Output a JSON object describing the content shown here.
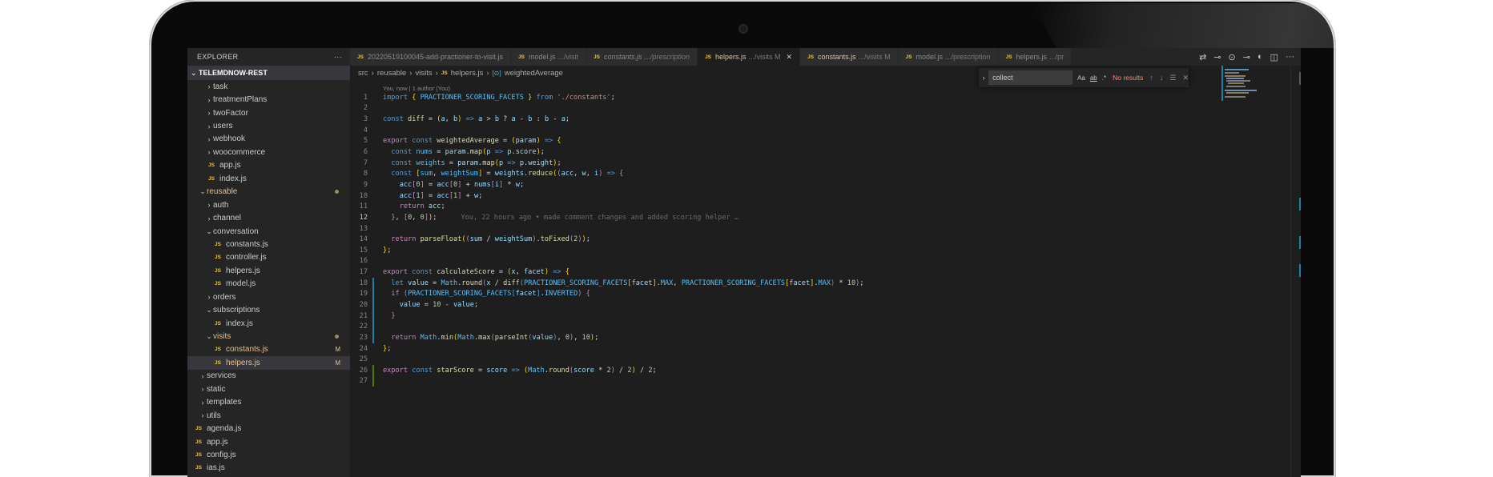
{
  "sidebar": {
    "title": "EXPLORER",
    "more": "···",
    "project": "TELEMDNOW-REST",
    "items": [
      {
        "type": "folder",
        "label": "task",
        "indent": 1,
        "open": false
      },
      {
        "type": "folder",
        "label": "treatmentPlans",
        "indent": 1,
        "open": false
      },
      {
        "type": "folder",
        "label": "twoFactor",
        "indent": 1,
        "open": false
      },
      {
        "type": "folder",
        "label": "users",
        "indent": 1,
        "open": false
      },
      {
        "type": "folder",
        "label": "webhook",
        "indent": 1,
        "open": false
      },
      {
        "type": "folder",
        "label": "woocommerce",
        "indent": 1,
        "open": false
      },
      {
        "type": "file",
        "label": "app.js",
        "indent": 1
      },
      {
        "type": "file",
        "label": "index.js",
        "indent": 1
      },
      {
        "type": "folder",
        "label": "reusable",
        "indent": 0,
        "open": true,
        "modified": true,
        "dot": true
      },
      {
        "type": "folder",
        "label": "auth",
        "indent": 1,
        "open": false
      },
      {
        "type": "folder",
        "label": "channel",
        "indent": 1,
        "open": false
      },
      {
        "type": "folder",
        "label": "conversation",
        "indent": 1,
        "open": true
      },
      {
        "type": "file",
        "label": "constants.js",
        "indent": 2
      },
      {
        "type": "file",
        "label": "controller.js",
        "indent": 2
      },
      {
        "type": "file",
        "label": "helpers.js",
        "indent": 2
      },
      {
        "type": "file",
        "label": "model.js",
        "indent": 2
      },
      {
        "type": "folder",
        "label": "orders",
        "indent": 1,
        "open": false
      },
      {
        "type": "folder",
        "label": "subscriptions",
        "indent": 1,
        "open": true
      },
      {
        "type": "file",
        "label": "index.js",
        "indent": 2
      },
      {
        "type": "folder",
        "label": "visits",
        "indent": 1,
        "open": true,
        "modified": true,
        "dot": true
      },
      {
        "type": "file",
        "label": "constants.js",
        "indent": 2,
        "modified": true,
        "badge": "M"
      },
      {
        "type": "file",
        "label": "helpers.js",
        "indent": 2,
        "modified": true,
        "badge": "M",
        "selected": true
      },
      {
        "type": "folder",
        "label": "services",
        "indent": 0,
        "open": false
      },
      {
        "type": "folder",
        "label": "static",
        "indent": 0,
        "open": false
      },
      {
        "type": "folder",
        "label": "templates",
        "indent": 0,
        "open": false
      },
      {
        "type": "folder",
        "label": "utils",
        "indent": 0,
        "open": false
      },
      {
        "type": "file",
        "label": "agenda.js",
        "indent": -1
      },
      {
        "type": "file",
        "label": "app.js",
        "indent": -1
      },
      {
        "type": "file",
        "label": "config.js",
        "indent": -1
      },
      {
        "type": "file",
        "label": "ias.js",
        "indent": -1
      }
    ]
  },
  "tabs": [
    {
      "label": "20220519100045-add-practioner-to-visit.js",
      "sub": "",
      "state": ""
    },
    {
      "label": "model.js",
      "sub": ".../visit",
      "state": ""
    },
    {
      "label": "constants.js",
      "sub": ".../prescription",
      "state": "italic"
    },
    {
      "label": "helpers.js",
      "sub": ".../visits M",
      "state": "active"
    },
    {
      "label": "constants.js",
      "sub": ".../visits M",
      "state": "mod"
    },
    {
      "label": "model.js",
      "sub": ".../prescription",
      "state": ""
    },
    {
      "label": "helpers.js",
      "sub": ".../pr",
      "state": ""
    }
  ],
  "tab_icon": "JS",
  "breadcrumb": [
    "src",
    "reusable",
    "visits",
    "helpers.js",
    "weightedAverage"
  ],
  "codelens": "You, now | 1 author (You)",
  "find": {
    "value": "collect",
    "opts": [
      "Aa",
      "ab",
      ".*"
    ],
    "result": "No results"
  },
  "code": [
    {
      "n": 1,
      "gut": "",
      "seg": [
        [
          "k",
          "import "
        ],
        [
          "p",
          "{ "
        ],
        [
          "c",
          "PRACTIONER_SCORING_FACETS"
        ],
        [
          "p",
          " }"
        ],
        [
          "k",
          " from "
        ],
        [
          "s",
          "'./constants'"
        ],
        [
          "op",
          ";"
        ]
      ]
    },
    {
      "n": 2,
      "gut": "",
      "seg": []
    },
    {
      "n": 3,
      "gut": "",
      "seg": [
        [
          "k",
          "const "
        ],
        [
          "f",
          "diff"
        ],
        [
          "op",
          " = "
        ],
        [
          "p",
          "("
        ],
        [
          "v",
          "a"
        ],
        [
          "op",
          ", "
        ],
        [
          "v",
          "b"
        ],
        [
          "p",
          ")"
        ],
        [
          "k",
          " => "
        ],
        [
          "v",
          "a"
        ],
        [
          "op",
          " > "
        ],
        [
          "v",
          "b"
        ],
        [
          "op",
          " ? "
        ],
        [
          "v",
          "a"
        ],
        [
          "op",
          " - "
        ],
        [
          "v",
          "b"
        ],
        [
          "op",
          " : "
        ],
        [
          "v",
          "b"
        ],
        [
          "op",
          " - "
        ],
        [
          "v",
          "a"
        ],
        [
          "op",
          ";"
        ]
      ]
    },
    {
      "n": 4,
      "gut": "",
      "seg": []
    },
    {
      "n": 5,
      "gut": "",
      "seg": [
        [
          "kc",
          "export "
        ],
        [
          "k",
          "const "
        ],
        [
          "f",
          "weightedAverage"
        ],
        [
          "op",
          " = "
        ],
        [
          "p",
          "("
        ],
        [
          "v",
          "param"
        ],
        [
          "p",
          ")"
        ],
        [
          "k",
          " => "
        ],
        [
          "p",
          "{"
        ]
      ]
    },
    {
      "n": 6,
      "gut": "",
      "seg": [
        [
          "op",
          "  "
        ],
        [
          "k",
          "const "
        ],
        [
          "c",
          "nums"
        ],
        [
          "op",
          " = "
        ],
        [
          "v",
          "param"
        ],
        [
          "op",
          "."
        ],
        [
          "f",
          "map"
        ],
        [
          "p",
          "("
        ],
        [
          "v",
          "p"
        ],
        [
          "k",
          " => "
        ],
        [
          "v",
          "p"
        ],
        [
          "op",
          "."
        ],
        [
          "v",
          "score"
        ],
        [
          "p",
          ")"
        ],
        [
          "op",
          ";"
        ]
      ]
    },
    {
      "n": 7,
      "gut": "",
      "seg": [
        [
          "op",
          "  "
        ],
        [
          "k",
          "const "
        ],
        [
          "c",
          "weights"
        ],
        [
          "op",
          " = "
        ],
        [
          "v",
          "param"
        ],
        [
          "op",
          "."
        ],
        [
          "f",
          "map"
        ],
        [
          "p",
          "("
        ],
        [
          "v",
          "p"
        ],
        [
          "k",
          " => "
        ],
        [
          "v",
          "p"
        ],
        [
          "op",
          "."
        ],
        [
          "v",
          "weight"
        ],
        [
          "p",
          ")"
        ],
        [
          "op",
          ";"
        ]
      ]
    },
    {
      "n": 8,
      "gut": "",
      "seg": [
        [
          "op",
          "  "
        ],
        [
          "k",
          "const "
        ],
        [
          "p",
          "["
        ],
        [
          "c",
          "sum"
        ],
        [
          "op",
          ", "
        ],
        [
          "c",
          "weightSum"
        ],
        [
          "p",
          "]"
        ],
        [
          "op",
          " = "
        ],
        [
          "v",
          "weights"
        ],
        [
          "op",
          "."
        ],
        [
          "f",
          "reduce"
        ],
        [
          "p",
          "("
        ],
        [
          "kc",
          "("
        ],
        [
          "v",
          "acc"
        ],
        [
          "op",
          ", "
        ],
        [
          "v",
          "w"
        ],
        [
          "op",
          ", "
        ],
        [
          "v",
          "i"
        ],
        [
          "kc",
          ")"
        ],
        [
          "k",
          " => "
        ],
        [
          "kc",
          "{"
        ]
      ]
    },
    {
      "n": 9,
      "gut": "",
      "seg": [
        [
          "op",
          "    "
        ],
        [
          "v",
          "acc"
        ],
        [
          "kc",
          "["
        ],
        [
          "n",
          "0"
        ],
        [
          "kc",
          "]"
        ],
        [
          "op",
          " = "
        ],
        [
          "v",
          "acc"
        ],
        [
          "kc",
          "["
        ],
        [
          "n",
          "0"
        ],
        [
          "kc",
          "]"
        ],
        [
          "op",
          " + "
        ],
        [
          "v",
          "nums"
        ],
        [
          "kc",
          "["
        ],
        [
          "v",
          "i"
        ],
        [
          "kc",
          "]"
        ],
        [
          "op",
          " * "
        ],
        [
          "v",
          "w"
        ],
        [
          "op",
          ";"
        ]
      ]
    },
    {
      "n": 10,
      "gut": "",
      "seg": [
        [
          "op",
          "    "
        ],
        [
          "v",
          "acc"
        ],
        [
          "kc",
          "["
        ],
        [
          "n",
          "1"
        ],
        [
          "kc",
          "]"
        ],
        [
          "op",
          " = "
        ],
        [
          "v",
          "acc"
        ],
        [
          "kc",
          "["
        ],
        [
          "n",
          "1"
        ],
        [
          "kc",
          "]"
        ],
        [
          "op",
          " + "
        ],
        [
          "v",
          "w"
        ],
        [
          "op",
          ";"
        ]
      ]
    },
    {
      "n": 11,
      "gut": "",
      "seg": [
        [
          "op",
          "    "
        ],
        [
          "kc",
          "return "
        ],
        [
          "v",
          "acc"
        ],
        [
          "op",
          ";"
        ]
      ]
    },
    {
      "n": 12,
      "gut": "",
      "cur": true,
      "seg": [
        [
          "op",
          "  "
        ],
        [
          "kc",
          "}"
        ],
        [
          "op",
          ", "
        ],
        [
          "kc",
          "["
        ],
        [
          "n",
          "0"
        ],
        [
          "op",
          ", "
        ],
        [
          "n",
          "0"
        ],
        [
          "kc",
          "]"
        ],
        [
          "p",
          ")"
        ],
        [
          "op",
          ";"
        ]
      ],
      "ghost": "You, 22 hours ago • made comment changes and added scoring helper …"
    },
    {
      "n": 13,
      "gut": "",
      "seg": []
    },
    {
      "n": 14,
      "gut": "",
      "seg": [
        [
          "op",
          "  "
        ],
        [
          "kc",
          "return "
        ],
        [
          "f",
          "parseFloat"
        ],
        [
          "p",
          "("
        ],
        [
          "kc",
          "("
        ],
        [
          "v",
          "sum"
        ],
        [
          "op",
          " / "
        ],
        [
          "v",
          "weightSum"
        ],
        [
          "kc",
          ")"
        ],
        [
          "op",
          "."
        ],
        [
          "f",
          "toFixed"
        ],
        [
          "kc",
          "("
        ],
        [
          "n",
          "2"
        ],
        [
          "kc",
          ")"
        ],
        [
          "p",
          ")"
        ],
        [
          "op",
          ";"
        ]
      ]
    },
    {
      "n": 15,
      "gut": "",
      "seg": [
        [
          "p",
          "}"
        ],
        [
          "op",
          ";"
        ]
      ]
    },
    {
      "n": 16,
      "gut": "",
      "seg": []
    },
    {
      "n": 17,
      "gut": "",
      "seg": [
        [
          "kc",
          "export "
        ],
        [
          "k",
          "const "
        ],
        [
          "f",
          "calculateScore"
        ],
        [
          "op",
          " = "
        ],
        [
          "p",
          "("
        ],
        [
          "v",
          "x"
        ],
        [
          "op",
          ", "
        ],
        [
          "v",
          "facet"
        ],
        [
          "p",
          ")"
        ],
        [
          "k",
          " => "
        ],
        [
          "p",
          "{"
        ]
      ]
    },
    {
      "n": 18,
      "gut": "mod",
      "seg": [
        [
          "op",
          "  "
        ],
        [
          "k",
          "let "
        ],
        [
          "v",
          "value"
        ],
        [
          "op",
          " = "
        ],
        [
          "c",
          "Math"
        ],
        [
          "op",
          "."
        ],
        [
          "f",
          "round"
        ],
        [
          "kc",
          "("
        ],
        [
          "v",
          "x"
        ],
        [
          "op",
          " / "
        ],
        [
          "f",
          "diff"
        ],
        [
          "k",
          "("
        ],
        [
          "c",
          "PRACTIONER_SCORING_FACETS"
        ],
        [
          "p",
          "["
        ],
        [
          "v",
          "facet"
        ],
        [
          "p",
          "]"
        ],
        [
          "op",
          "."
        ],
        [
          "c",
          "MAX"
        ],
        [
          "op",
          ", "
        ],
        [
          "c",
          "PRACTIONER_SCORING_FACETS"
        ],
        [
          "p",
          "["
        ],
        [
          "v",
          "facet"
        ],
        [
          "p",
          "]"
        ],
        [
          "op",
          "."
        ],
        [
          "c",
          "MAX"
        ],
        [
          "k",
          ")"
        ],
        [
          "op",
          " * "
        ],
        [
          "n",
          "10"
        ],
        [
          "kc",
          ")"
        ],
        [
          "op",
          ";"
        ]
      ]
    },
    {
      "n": 19,
      "gut": "mod",
      "seg": [
        [
          "op",
          "  "
        ],
        [
          "kc",
          "if "
        ],
        [
          "kc",
          "("
        ],
        [
          "c",
          "PRACTIONER_SCORING_FACETS"
        ],
        [
          "k",
          "["
        ],
        [
          "v",
          "facet"
        ],
        [
          "k",
          "]"
        ],
        [
          "op",
          "."
        ],
        [
          "c",
          "INVERTED"
        ],
        [
          "kc",
          ")"
        ],
        [
          "op",
          " "
        ],
        [
          "kc",
          "{"
        ]
      ]
    },
    {
      "n": 20,
      "gut": "mod",
      "seg": [
        [
          "op",
          "    "
        ],
        [
          "v",
          "value"
        ],
        [
          "op",
          " = "
        ],
        [
          "n",
          "10"
        ],
        [
          "op",
          " - "
        ],
        [
          "v",
          "value"
        ],
        [
          "op",
          ";"
        ]
      ]
    },
    {
      "n": 21,
      "gut": "mod",
      "seg": [
        [
          "op",
          "  "
        ],
        [
          "kc",
          "}"
        ]
      ]
    },
    {
      "n": 22,
      "gut": "mod",
      "seg": []
    },
    {
      "n": 23,
      "gut": "mod",
      "seg": [
        [
          "op",
          "  "
        ],
        [
          "kc",
          "return "
        ],
        [
          "c",
          "Math"
        ],
        [
          "op",
          "."
        ],
        [
          "f",
          "min"
        ],
        [
          "p",
          "("
        ],
        [
          "c",
          "Math"
        ],
        [
          "op",
          "."
        ],
        [
          "f",
          "max"
        ],
        [
          "kc",
          "("
        ],
        [
          "f",
          "parseInt"
        ],
        [
          "k",
          "("
        ],
        [
          "v",
          "value"
        ],
        [
          "k",
          ")"
        ],
        [
          "op",
          ", "
        ],
        [
          "n",
          "0"
        ],
        [
          "kc",
          ")"
        ],
        [
          "op",
          ", "
        ],
        [
          "n",
          "10"
        ],
        [
          "p",
          ")"
        ],
        [
          "op",
          ";"
        ]
      ]
    },
    {
      "n": 24,
      "gut": "",
      "seg": [
        [
          "p",
          "}"
        ],
        [
          "op",
          ";"
        ]
      ]
    },
    {
      "n": 25,
      "gut": "",
      "seg": []
    },
    {
      "n": 26,
      "gut": "add",
      "seg": [
        [
          "kc",
          "export "
        ],
        [
          "k",
          "const "
        ],
        [
          "f",
          "starScore"
        ],
        [
          "op",
          " = "
        ],
        [
          "v",
          "score"
        ],
        [
          "k",
          " => "
        ],
        [
          "p",
          "("
        ],
        [
          "c",
          "Math"
        ],
        [
          "op",
          "."
        ],
        [
          "f",
          "round"
        ],
        [
          "kc",
          "("
        ],
        [
          "v",
          "score"
        ],
        [
          "op",
          " * "
        ],
        [
          "n",
          "2"
        ],
        [
          "kc",
          ")"
        ],
        [
          "op",
          " / "
        ],
        [
          "n",
          "2"
        ],
        [
          "p",
          ")"
        ],
        [
          "op",
          " / "
        ],
        [
          "n",
          "2"
        ],
        [
          "op",
          ";"
        ]
      ]
    },
    {
      "n": 27,
      "gut": "add",
      "seg": []
    }
  ],
  "colors": {
    "accent": "#1b81a8",
    "modified": "#e2c08d",
    "js_icon": "#e8c547",
    "no_results": "#f48771"
  }
}
